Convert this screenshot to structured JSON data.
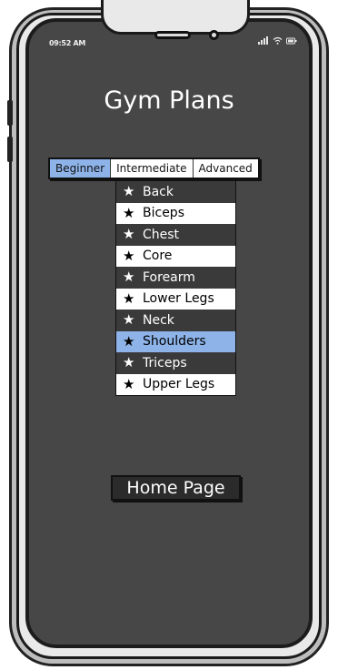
{
  "status": {
    "time": "09:52 AM",
    "signal_icon": "signal-bars-icon",
    "wifi_icon": "wifi-icon",
    "battery_icon": "battery-icon"
  },
  "app": {
    "title": "Gym Plans"
  },
  "tabs": [
    {
      "label": "Beginner",
      "active": true
    },
    {
      "label": "Intermediate",
      "active": false
    },
    {
      "label": "Advanced",
      "active": false
    }
  ],
  "muscle_groups": [
    {
      "label": "Back"
    },
    {
      "label": "Biceps"
    },
    {
      "label": "Chest"
    },
    {
      "label": "Core"
    },
    {
      "label": "Forearm"
    },
    {
      "label": "Lower Legs"
    },
    {
      "label": "Neck"
    },
    {
      "label": "Shoulders",
      "selected": true
    },
    {
      "label": "Triceps"
    },
    {
      "label": "Upper Legs"
    }
  ],
  "home_button": {
    "label": "Home Page"
  },
  "colors": {
    "screen_bg": "#474747",
    "accent": "#8db3e8",
    "row_dark": "#3a3a3a",
    "row_light": "#ffffff"
  }
}
